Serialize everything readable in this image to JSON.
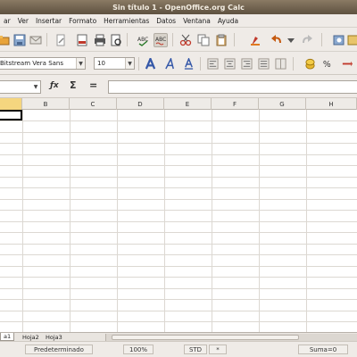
{
  "window": {
    "title": "Sin título 1 - OpenOffice.org Calc"
  },
  "menu": [
    "ar",
    "Ver",
    "Insertar",
    "Formato",
    "Herramientas",
    "Datos",
    "Ventana",
    "Ayuda"
  ],
  "toolbar_standard": {
    "icons": [
      "open-icon",
      "save-icon",
      "email-icon",
      "edit-file-icon",
      "export-pdf-icon",
      "print-icon",
      "print-preview-icon",
      "spellcheck-icon",
      "autospellcheck-icon",
      "cut-icon",
      "copy-icon",
      "paste-icon",
      "clone-formatting-icon",
      "undo-icon",
      "redo-icon",
      "navigator-icon"
    ]
  },
  "toolbar_formatting": {
    "font_name": "Bitstream Vera Sans",
    "font_size": "10",
    "icons": [
      "bold-icon",
      "italic-icon",
      "underline-icon",
      "align-left-icon",
      "align-center-icon",
      "align-right-icon",
      "justify-icon",
      "merge-cells-icon",
      "currency-icon",
      "percent-icon"
    ]
  },
  "formula_bar": {
    "name_box": "",
    "function_wizard": "ƒx",
    "sum_symbol": "Σ",
    "equals_symbol": "=",
    "input_value": ""
  },
  "grid": {
    "columns": [
      "",
      "B",
      "C",
      "D",
      "E",
      "F",
      "G",
      "H"
    ],
    "active_column": 0
  },
  "sheets": [
    "a1",
    "Hoja2",
    "Hoja3"
  ],
  "status": {
    "style": "Predeterminado",
    "zoom": "100%",
    "mode": "STD",
    "modified": "*",
    "sum": "Suma=0"
  },
  "colors": {
    "titlebar": "#6f6150",
    "chrome": "#efebe7",
    "active_header": "#f5d67f"
  }
}
